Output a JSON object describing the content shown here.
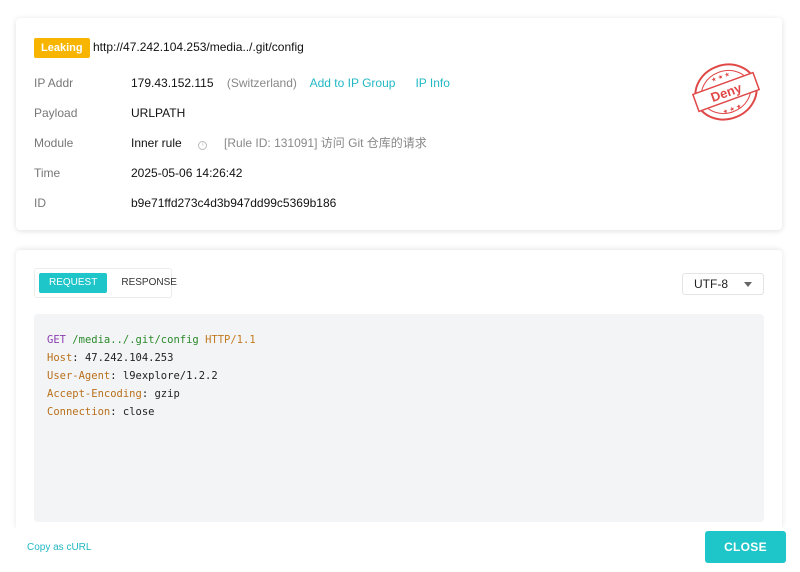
{
  "event": {
    "status_badge": "Leaking",
    "url": "http://47.242.104.253/media../.git/config",
    "stamp_text": "Deny",
    "fields": {
      "ip_label": "IP Addr",
      "ip_value": "179.43.152.115",
      "ip_country": "(Switzerland)",
      "add_ip_group": "Add to IP Group",
      "ip_info": "IP Info",
      "payload_label": "Payload",
      "payload_value": "URLPATH",
      "module_label": "Module",
      "module_value": "Inner rule",
      "module_info_icon": "i",
      "module_detail": "[Rule ID: 131091] 访问 Git 仓库的请求",
      "time_label": "Time",
      "time_value": "2025-05-06 14:26:42",
      "id_label": "ID",
      "id_value": "b9e71ffd273c4d3b947dd99c5369b186"
    }
  },
  "viewer": {
    "tabs": [
      "REQUEST",
      "RESPONSE"
    ],
    "active_tab": "REQUEST",
    "encoding": "UTF-8",
    "request": {
      "method": "GET",
      "path": "/media../.git/config",
      "protocol": "HTTP/1.1",
      "headers": [
        {
          "name": "Host",
          "value": "47.242.104.253"
        },
        {
          "name": "User-Agent",
          "value": "l9explore/1.2.2"
        },
        {
          "name": "Accept-Encoding",
          "value": "gzip"
        },
        {
          "name": "Connection",
          "value": "close"
        }
      ]
    }
  },
  "footer": {
    "copy_curl": "Copy as cURL",
    "close": "CLOSE"
  },
  "colors": {
    "accent": "#1ec5c9",
    "badge": "#f7b500",
    "stamp": "#e04848"
  }
}
